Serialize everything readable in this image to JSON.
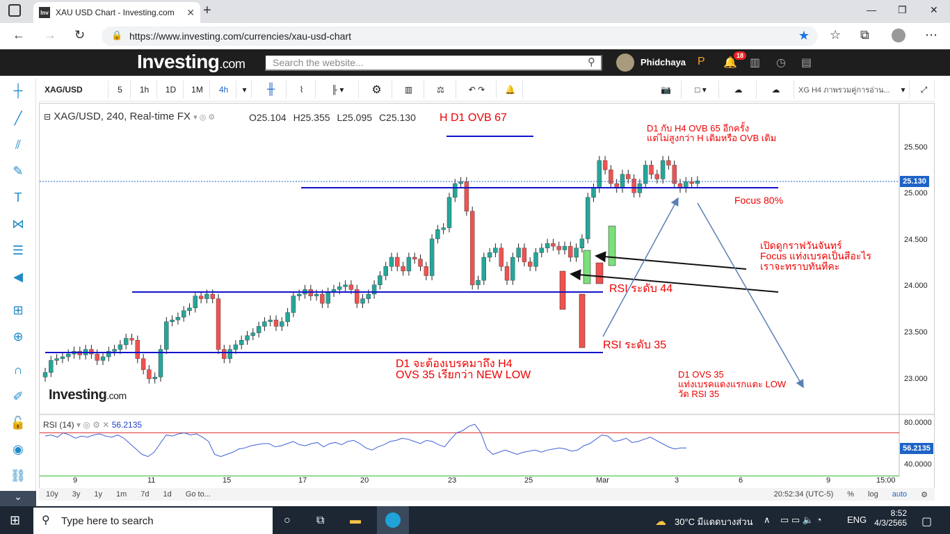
{
  "browser": {
    "tab_title": "XAU USD Chart - Investing.com",
    "favicon_text": "Inv",
    "url": "https://www.investing.com/currencies/xau-usd-chart"
  },
  "site": {
    "logo_main": "Investing",
    "logo_suffix": ".com",
    "search_placeholder": "Search the website...",
    "username": "Phidchaya",
    "notification_count": "18"
  },
  "toolbar": {
    "symbol": "XAG/USD",
    "intervals": [
      "5",
      "1h",
      "1D",
      "1M",
      "4h"
    ],
    "active_interval": "4h",
    "template_label": "XG H4 ภาพรวมคู่การอ่าน..."
  },
  "chart": {
    "legend": "XAG/USD, 240, Real-time FX",
    "open": "O25.104",
    "high": "H25.355",
    "low": "L25.095",
    "close": "C25.130",
    "current_price": "25.130",
    "price_ticks": [
      "25.500",
      "25.000",
      "24.500",
      "24.000",
      "23.500",
      "23.000"
    ],
    "x_ticks": [
      "9",
      "11",
      "15",
      "17",
      "20",
      "23",
      "25",
      "Mar",
      "3",
      "6",
      "9",
      "15:00"
    ],
    "watermark_main": "Investing",
    "watermark_suffix": ".com"
  },
  "annotations": {
    "h_d1_ovb": "H D1 OVB 67",
    "d1_h4_line1": "D1 กับ H4 OVB 65 อีกครั้ง",
    "d1_h4_line2": "แต่ไม่สูงกว่า H เดิมหรือ OVB เดิม",
    "focus": "Focus 80%",
    "monday_line1": "เปิดดูกราฟวันจันทร์",
    "monday_line2": "Focus แท่งเบรคเป็นสีอะไร",
    "monday_line3": "เราจะทราบทันทีคะ",
    "rsi44": "RSI ระดับ 44",
    "rsi35": "RSI ระดับ 35",
    "d1_break_line1": "D1 จะต้องเบรคมาถึง H4",
    "d1_break_line2": "OVS 35 เรียกว่า NEW LOW",
    "d1_ovs_line1": "D1 OVS 35",
    "d1_ovs_line2": "แท่งเบรคแดงแรกแตะ LOW",
    "d1_ovs_line3": "วัด RSI 35"
  },
  "rsi": {
    "label": "RSI (14)",
    "value": "56.2135",
    "ticks": [
      "80.0000",
      "40.0000"
    ],
    "overbought": 70,
    "oversold": 30
  },
  "bottom_bar": {
    "ranges": [
      "10y",
      "3y",
      "1y",
      "1m",
      "7d",
      "1d",
      "Go to..."
    ],
    "time": "20:52:34 (UTC-5)",
    "percent": "%",
    "log": "log",
    "auto": "auto"
  },
  "taskbar": {
    "search_placeholder": "Type here to search",
    "weather": "30°C มีแดดบางส่วน",
    "lang": "ENG",
    "time": "8:52",
    "date": "4/3/2565"
  },
  "colors": {
    "up": "#26a69a",
    "down": "#ef5350",
    "level_line": "#1111cc",
    "annotation": "#e00000",
    "header_bg": "#1e1e1e"
  }
}
